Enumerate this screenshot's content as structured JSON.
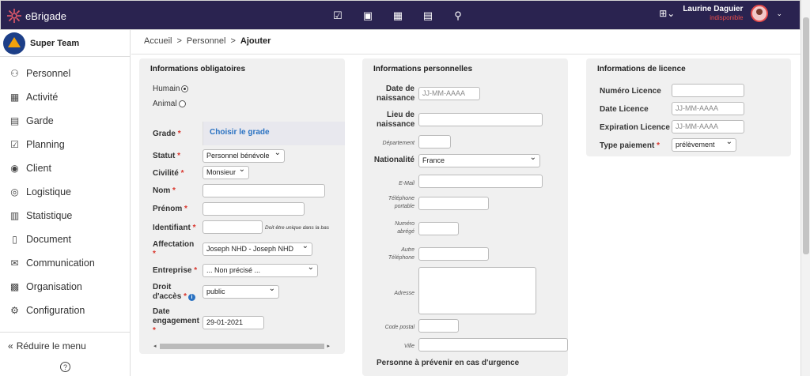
{
  "app": {
    "brand": "eBrigade",
    "user_name": "Laurine Daguier",
    "user_status": "indisponible"
  },
  "sidebar": {
    "team_name": "Super Team",
    "items": [
      {
        "label": "Personnel",
        "icon": "person-icon"
      },
      {
        "label": "Activité",
        "icon": "calendar-icon"
      },
      {
        "label": "Garde",
        "icon": "clipboard-icon"
      },
      {
        "label": "Planning",
        "icon": "calendar-check-icon"
      },
      {
        "label": "Client",
        "icon": "user-circle-icon"
      },
      {
        "label": "Logistique",
        "icon": "target-icon"
      },
      {
        "label": "Statistique",
        "icon": "bar-chart-icon"
      },
      {
        "label": "Document",
        "icon": "file-icon"
      },
      {
        "label": "Communication",
        "icon": "envelope-icon"
      },
      {
        "label": "Organisation",
        "icon": "building-icon"
      },
      {
        "label": "Configuration",
        "icon": "gear-icon"
      }
    ],
    "reduce_label": "Réduire le menu"
  },
  "breadcrumb": [
    "Accueil",
    "Personnel",
    "Ajouter"
  ],
  "obligatoires": {
    "title": "Informations obligatoires",
    "humain": "Humain",
    "animal": "Animal",
    "grade_label": "Grade",
    "grade_link": "Choisir le grade",
    "statut_label": "Statut",
    "statut_value": "Personnel bénévole",
    "civilite_label": "Civilité",
    "civilite_value": "Monsieur",
    "nom_label": "Nom",
    "prenom_label": "Prénom",
    "identifiant_label": "Identifiant",
    "identifiant_note": "Doit être unique dans la bas",
    "affectation_label": "Affectation",
    "affectation_value": "Joseph NHD - Joseph NHD",
    "entreprise_label": "Entreprise",
    "entreprise_value": "... Non précisé ...",
    "droit_label_1": "Droit",
    "droit_label_2": "d'accès",
    "droit_value": "public",
    "date_label_1": "Date",
    "date_label_2": "engagement",
    "date_value": "29-01-2021"
  },
  "personnelles": {
    "title": "Informations personnelles",
    "naissance_label_1": "Date de",
    "naissance_label_2": "naissance",
    "naissance_placeholder": "JJ-MM-AAAA",
    "lieu_label_1": "Lieu de",
    "lieu_label_2": "naissance",
    "departement_label": "Département",
    "nationalite_label": "Nationalité",
    "nationalite_value": "France",
    "email_label": "E-Mail",
    "tel_label_1": "Téléphone",
    "tel_label_2": "portable",
    "num_label_1": "Numéro",
    "num_label_2": "abrégé",
    "autre_label_1": "Autre",
    "autre_label_2": "Téléphone",
    "adresse_label": "Adresse",
    "cp_label": "Code postal",
    "ville_label": "Ville",
    "urgence_label": "Personne à prévenir en cas d'urgence"
  },
  "licence": {
    "title": "Informations de licence",
    "numero_label": "Numéro Licence",
    "date_label": "Date Licence",
    "date_placeholder": "JJ-MM-AAAA",
    "expiration_label": "Expiration Licence",
    "expiration_placeholder": "JJ-MM-AAAA",
    "paiement_label": "Type paiement",
    "paiement_value": "prélèvement"
  },
  "colors": {
    "topbar": "#2a2350",
    "accent_link": "#2a72c2",
    "required": "#d9342b",
    "status_unavailable": "#e64b4b"
  }
}
